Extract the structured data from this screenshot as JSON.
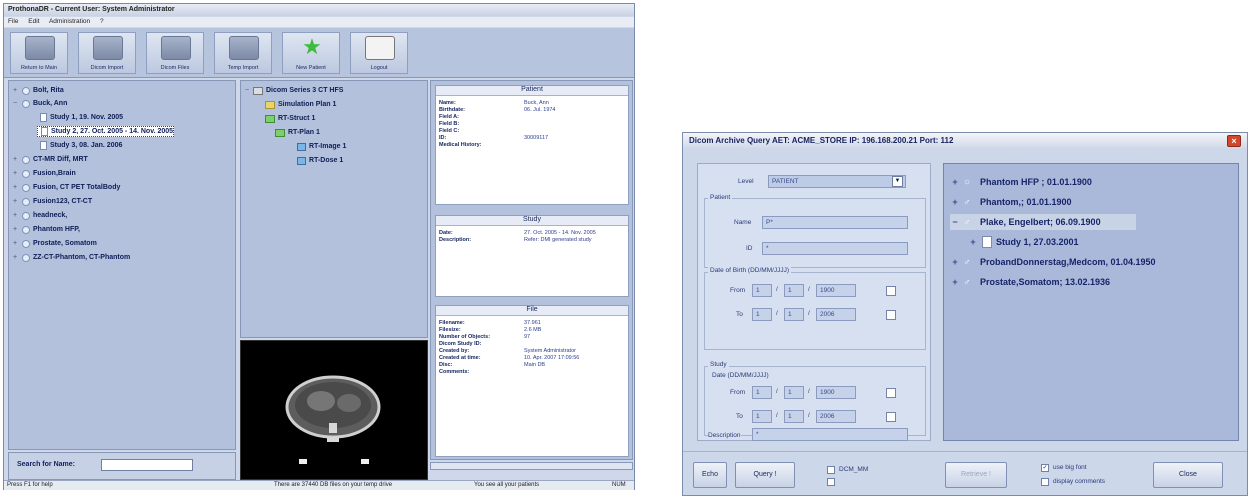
{
  "app": {
    "title": "ProthonaDR - Current User: System Administrator",
    "menu": [
      "File",
      "Edit",
      "Administration",
      "?"
    ],
    "toolbar": [
      {
        "label": "Return to Main",
        "icon": "return-icon"
      },
      {
        "label": "Dicom Import",
        "icon": "dicom-import-icon"
      },
      {
        "label": "Dicom Files",
        "icon": "dicom-files-icon"
      },
      {
        "label": "Temp Import",
        "icon": "temp-import-icon"
      },
      {
        "label": "New Patient",
        "icon": "star-icon"
      },
      {
        "label": "Logout",
        "icon": "logout-icon"
      }
    ],
    "tree": [
      {
        "label": "Bolt, Rita",
        "toggle": "+"
      },
      {
        "label": "Buck, Ann",
        "toggle": "−"
      },
      {
        "label": "Study 1, 19. Nov. 2005",
        "toggle": ""
      },
      {
        "label": "Study 2, 27. Oct. 2005 - 14. Nov. 2005",
        "toggle": ""
      },
      {
        "label": "Study 3, 08. Jan. 2006",
        "toggle": ""
      },
      {
        "label": "CT-MR Diff, MRT",
        "toggle": "+"
      },
      {
        "label": "Fusion,Brain",
        "toggle": "+"
      },
      {
        "label": "Fusion, CT PET TotalBody",
        "toggle": "+"
      },
      {
        "label": "Fusion123, CT-CT",
        "toggle": "+"
      },
      {
        "label": "headneck,",
        "toggle": "+"
      },
      {
        "label": "Phantom HFP,",
        "toggle": "+"
      },
      {
        "label": "Prostate, Somatom",
        "toggle": "+"
      },
      {
        "label": "ZZ-CT-Phantom, CT-Phantom",
        "toggle": "+"
      }
    ],
    "search": {
      "label": "Search for Name:",
      "value": ""
    },
    "dicom_tree": [
      {
        "label": "Dicom Series 3 CT HFS",
        "kind": "series"
      },
      {
        "label": "Simulation Plan 1",
        "kind": "folder"
      },
      {
        "label": "RT-Struct 1",
        "kind": "green"
      },
      {
        "label": "RT-Plan 1",
        "kind": "green"
      },
      {
        "label": "RT-Image 1",
        "kind": "blue"
      },
      {
        "label": "RT-Dose 1",
        "kind": "blue"
      }
    ],
    "patient_box": {
      "title": "Patient",
      "rows": [
        {
          "k": "Name:",
          "v": "Buck, Ann"
        },
        {
          "k": "Birthdate:",
          "v": "06. Jul. 1974"
        },
        {
          "k": "Field A:",
          "v": ""
        },
        {
          "k": "Field B:",
          "v": ""
        },
        {
          "k": "Field C:",
          "v": ""
        },
        {
          "k": "ID:",
          "v": "30009117"
        },
        {
          "k": "Medical History:",
          "v": ""
        }
      ]
    },
    "study_box": {
      "title": "Study",
      "rows": [
        {
          "k": "Date:",
          "v": "27. Oct. 2005 - 14. Nov. 2005"
        },
        {
          "k": "Description:",
          "v": "Refer: DMI generated study"
        }
      ]
    },
    "file_box": {
      "title": "File",
      "rows": [
        {
          "k": "Filename:",
          "v": "37.961"
        },
        {
          "k": "Filesize:",
          "v": "2.6 MB"
        },
        {
          "k": "Number of Objects:",
          "v": "97"
        },
        {
          "k": "Dicom Study ID:",
          "v": ""
        },
        {
          "k": "Created by:",
          "v": "System Administrator"
        },
        {
          "k": "Created at time:",
          "v": "10. Apr. 2007 17:09:56"
        },
        {
          "k": "Disc:",
          "v": "Main DB"
        },
        {
          "k": "",
          "v": ""
        },
        {
          "k": "Comments:",
          "v": ""
        }
      ]
    },
    "status": {
      "left": "Press F1 for help",
      "center": "There are 37440 DB files on your temp drive",
      "right": "You see all your patients",
      "far_right": "NUM"
    }
  },
  "dialog": {
    "title": "Dicom Archive Query   AET: ACME_STORE  IP: 196.168.200.21 Port: 112",
    "level_label": "Level",
    "level_value": "PATIENT",
    "patient_group": "Patient",
    "name_label": "Name",
    "name_value": "P*",
    "id_label": "ID",
    "id_value": "*",
    "dob_group": "Date of Birth (DD/MM/JJJJ)",
    "from_label": "From",
    "to_label": "To",
    "dob_from": [
      "1",
      "1",
      "1900"
    ],
    "dob_to": [
      "1",
      "1",
      "2006"
    ],
    "study_group": "Study",
    "study_date_group": "Date (DD/MM/JJJJ)",
    "study_from": [
      "1",
      "1",
      "1900"
    ],
    "study_to": [
      "1",
      "1",
      "2006"
    ],
    "description_label": "Description",
    "description_value": "*",
    "results": [
      {
        "toggle": "+",
        "sym": "○",
        "label": "Phantom HFP ; 01.01.1900"
      },
      {
        "toggle": "+",
        "sym": "♂",
        "label": "Phantom,; 01.01.1900"
      },
      {
        "toggle": "−",
        "sym": "♂",
        "label": "Plake, Engelbert; 06.09.1900"
      },
      {
        "toggle": "+",
        "sym": "",
        "label": "Study 1, 27.03.2001"
      },
      {
        "toggle": "+",
        "sym": "♂",
        "label": "ProbandDonnerstag,Medcom, 01.04.1950"
      },
      {
        "toggle": "+",
        "sym": "♂",
        "label": "Prostate,Somatom; 13.02.1936"
      }
    ],
    "buttons": {
      "echo": "Echo",
      "query": "Query !",
      "retrieve": "Retrieve !",
      "close": "Close"
    },
    "checks": {
      "dcm_mm": "DCM_MM",
      "big_font": "use big font",
      "display_comments": "display comments"
    }
  }
}
